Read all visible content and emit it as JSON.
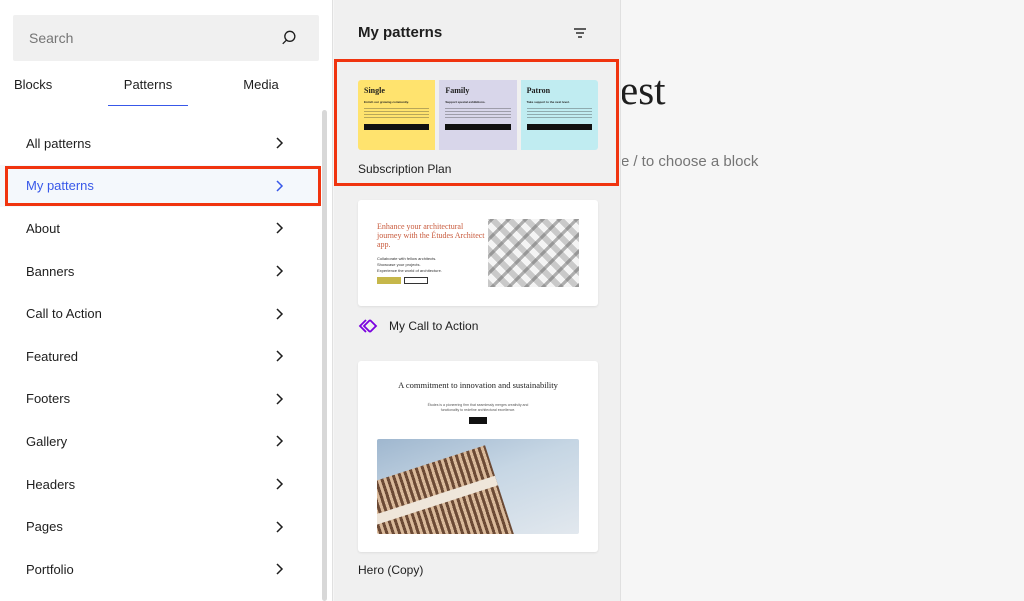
{
  "inserter": {
    "search": {
      "placeholder": "Search",
      "value": ""
    },
    "tabs": [
      {
        "label": "Blocks",
        "selected": false
      },
      {
        "label": "Patterns",
        "selected": true
      },
      {
        "label": "Media",
        "selected": false
      }
    ],
    "categories": [
      {
        "label": "All patterns"
      },
      {
        "label": "My patterns",
        "selected": true
      },
      {
        "label": "About"
      },
      {
        "label": "Banners"
      },
      {
        "label": "Call to Action"
      },
      {
        "label": "Featured"
      },
      {
        "label": "Footers"
      },
      {
        "label": "Gallery"
      },
      {
        "label": "Headers"
      },
      {
        "label": "Pages"
      },
      {
        "label": "Portfolio"
      }
    ]
  },
  "patterns_panel": {
    "title": "My patterns",
    "patterns": [
      {
        "label": "Subscription Plan",
        "preview": {
          "columns": [
            {
              "title": "Single",
              "subtitle": "Enrich our growing community.",
              "button": "$9.99 / year"
            },
            {
              "title": "Family",
              "subtitle": "Support special exhibitions.",
              "button": "$499 / year"
            },
            {
              "title": "Patron",
              "subtitle": "Take support to the next level.",
              "button": "$999 / year"
            }
          ]
        }
      },
      {
        "label": "My Call to Action",
        "synced": true,
        "preview": {
          "heading": "Enhance your architectural journey with the Études Architect app.",
          "items": [
            "Collaborate with fellow architects.",
            "Showcase your projects.",
            "Experience the world of architecture."
          ]
        }
      },
      {
        "label": "Hero (Copy)",
        "preview": {
          "heading": "A commitment to innovation and sustainability",
          "text": "Études is a pioneering firm that seamlessly merges creativity and functionality to redefine architectural excellence.",
          "button": "About us"
        }
      }
    ]
  },
  "canvas": {
    "title_fragment": "est",
    "hint_fragment": "/ to choose a block"
  },
  "colors": {
    "accent": "#3858e9",
    "highlight": "#f0340f",
    "synced_icon": "#7a00df"
  },
  "icons": {
    "search": "search-icon",
    "chevron": "chevron-right-icon",
    "filter": "filter-icon",
    "synced": "synced-pattern-icon"
  }
}
